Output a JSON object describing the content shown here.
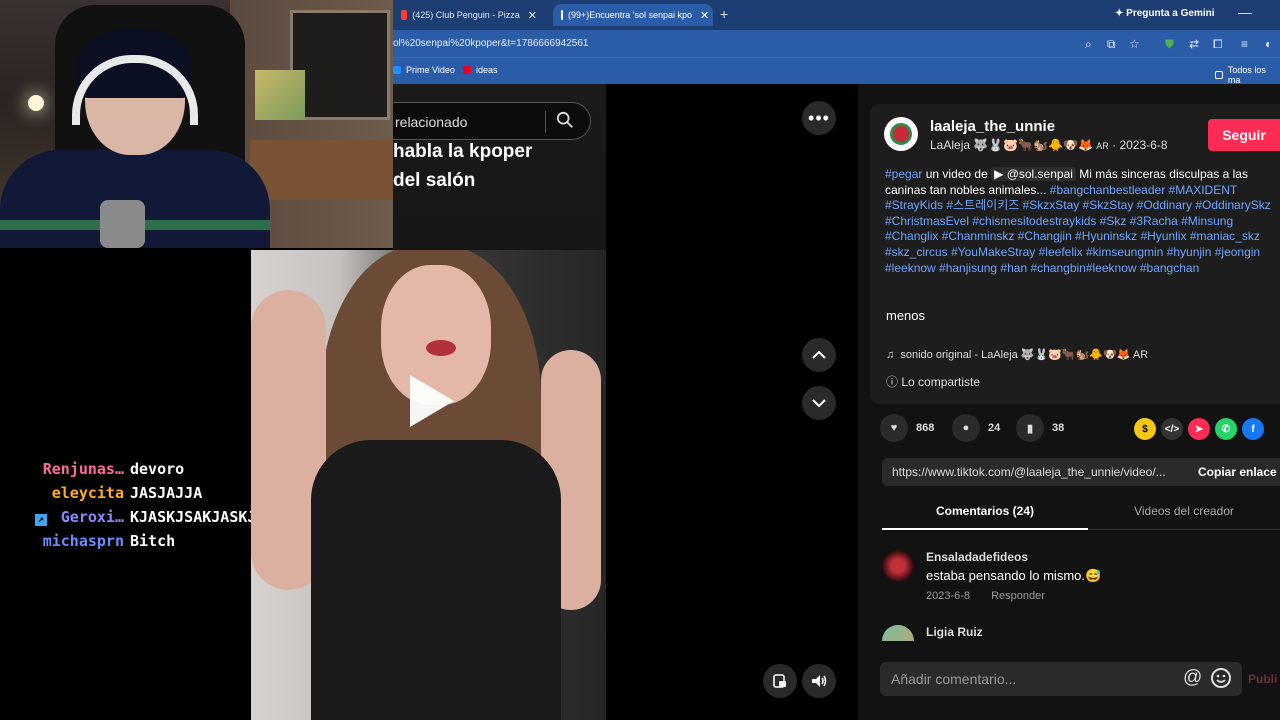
{
  "browser": {
    "tabs": [
      {
        "label": "(425) Club Penguin - Pizza",
        "color": "#ff3b30"
      },
      {
        "label": "(99+)Encuentra 'sol senpai kpo",
        "color": "#111111"
      }
    ],
    "gemini_label": "Pregunta a Gemini",
    "url": "ol%20senpai%20kpoper&t=1786666942561",
    "bookmarks": {
      "prime": "Prime Video",
      "ideas": "ideas",
      "all": "Todos los ma"
    }
  },
  "stream_chat": [
    {
      "user": "Renjunas…",
      "message": "devoro",
      "color": "#ff6b9a"
    },
    {
      "user": "eleycita",
      "message": "JASJAJJA",
      "color": "#ffb020"
    },
    {
      "user": "Geroxi…",
      "message": "KJASKJSAKJASKJSAKJSJ",
      "color": "#8a8aff",
      "badge": true
    },
    {
      "user": "michasprn",
      "message": "Bitch",
      "color": "#6d8cff"
    }
  ],
  "tiktok": {
    "related_text": "relacionado",
    "overlay_lines": [
      "habla la kpoper",
      "del salón"
    ],
    "author": {
      "username": "laaleja_the_unnie",
      "display": "LaAleja 🐺🐰🐷🐂🐿️🐥🐶🦊",
      "region": "AR",
      "date": "2023-6-8"
    },
    "follow_label": "Seguir",
    "caption": {
      "pre": "un video de",
      "first_tag": "#pegar",
      "mention": "@sol.senpai",
      "text": " Mi más sinceras disculpas a las caninas tan nobles animales... ",
      "tags": "#bangchanbestleader #MAXIDENT #StrayKids #스트레이키즈 #SkzxStay #SkzStay #Oddinary #OddinarySkz #ChristmasEvel #chismesitodestraykids #Skz #3Racha #Minsung #Changlix #Chanminskz #Changjin #Hyuninskz #Hyunlix #maniac_skz #skz_circus #YouMakeStray #leefelix #kimseungmin #hyunjin #jeongin #leeknow #hanjisung #han #changbin#leeknow #bangchan"
    },
    "less_label": "menos",
    "music": "sonido original - LaAleja 🐺🐰🐷🐂🐿️🐥🐶🦊 AR",
    "shared_label": "Lo compartiste",
    "stats": {
      "likes": "868",
      "comments": "24",
      "saves": "38"
    },
    "link": "https://www.tiktok.com/@laaleja_the_unnie/video/...",
    "copy_link_label": "Copiar enlace",
    "tabs": {
      "comments": "Comentarios (24)",
      "creator": "Videos del creador"
    },
    "comments": [
      {
        "user": "Ensaladadefideos",
        "text": "estaba pensando lo mismo.😅",
        "date": "2023-6-8",
        "reply": "Responder"
      },
      {
        "user": "Ligia Ruiz",
        "text": "",
        "date": "",
        "reply": ""
      }
    ],
    "comment_placeholder": "Añadir comentario...",
    "publish_label": "Publi"
  }
}
